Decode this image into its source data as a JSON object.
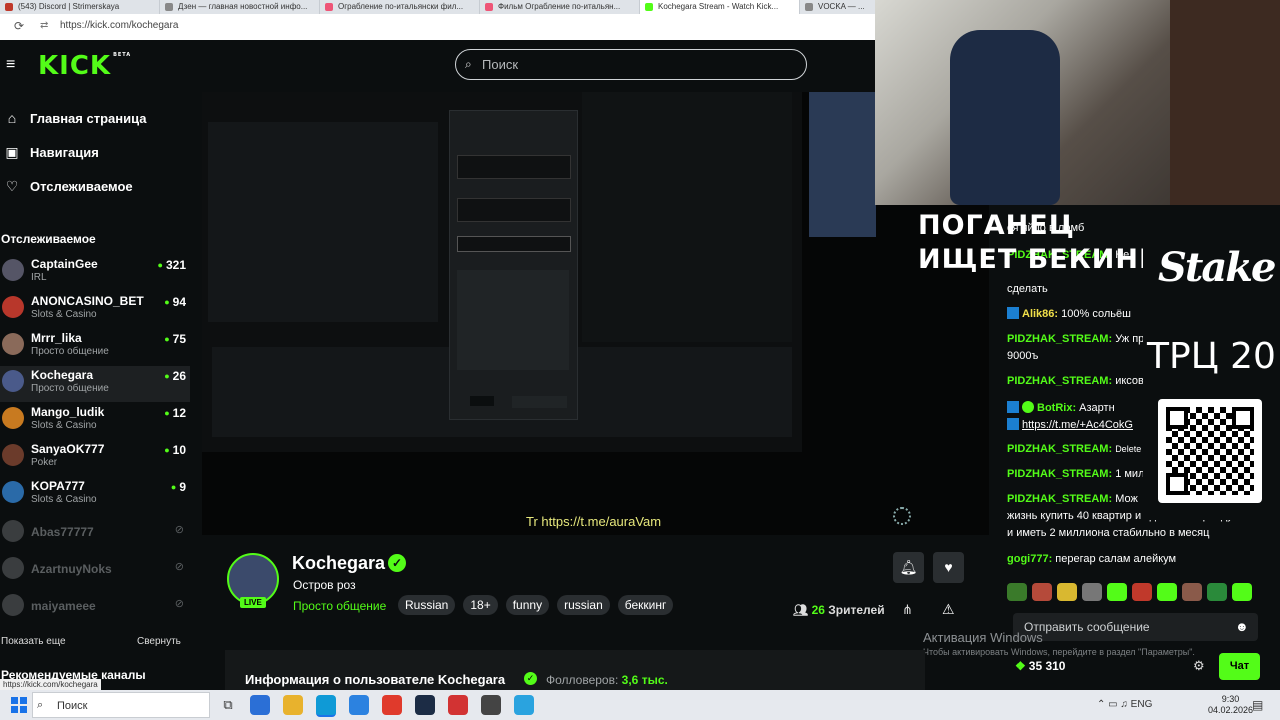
{
  "browser": {
    "tabs": [
      "(543) Discord | Strimerskaya",
      "Дзен — главная новостной инфо...",
      "Ограбление по-итальянски фил...",
      "Фильм Ограбление по-итальян...",
      "Kochegara Stream - Watch Kick...",
      "VOCKA — ..."
    ],
    "url": "https://kick.com/kochegara"
  },
  "header": {
    "logo": "KICK",
    "logo_beta": "BETA",
    "search_placeholder": "Поиск"
  },
  "sidebar": {
    "nav": [
      {
        "label": "Главная страница",
        "icon": "home-icon"
      },
      {
        "label": "Навигация",
        "icon": "browse-icon"
      },
      {
        "label": "Отслеживаемое",
        "icon": "heart-icon"
      }
    ],
    "section_title": "Отслеживаемое",
    "channels": [
      {
        "name": "CaptainGee",
        "category": "IRL",
        "viewers": "321"
      },
      {
        "name": "ANONCASINO_BET",
        "category": "Slots & Casino",
        "viewers": "94"
      },
      {
        "name": "Mrrr_lika",
        "category": "Просто общение",
        "viewers": "75"
      },
      {
        "name": "Kochegara",
        "category": "Просто общение",
        "viewers": "26"
      },
      {
        "name": "Mango_ludik",
        "category": "Slots & Casino",
        "viewers": "12"
      },
      {
        "name": "SanyaOK777",
        "category": "Poker",
        "viewers": "10"
      },
      {
        "name": "KOPA777",
        "category": "Slots & Casino",
        "viewers": "9"
      }
    ],
    "offline_channels": [
      "Abas77777",
      "AzartnuyNoks",
      "maiyameee"
    ],
    "show_more": "Показать еще",
    "collapse": "Свернуть",
    "recommended": "Рекомендуемые каналы",
    "status_url": "https://kick.com/kochegara"
  },
  "player": {
    "promo_text": "Tr https://t.me/auraVam"
  },
  "overlay": {
    "line1": "ПОГАНЕЦ",
    "line2": "ИЩЕТ БЕКИНГ",
    "stake": "Stake",
    "trc": "ТРЦ 20"
  },
  "chat": {
    "messages": [
      {
        "user": "",
        "text": "ся яйцо в ломб"
      },
      {
        "user": "PIDZHAK_STREAM:",
        "text": "Не"
      },
      {
        "user": "",
        "text": "сделать"
      },
      {
        "user": "Alik86:",
        "text": "100% сольёш"
      },
      {
        "user": "PIDZHAK_STREAM:",
        "text": "Уж пр"
      },
      {
        "user": "",
        "text": "9000ъ"
      },
      {
        "user": "PIDZHAK_STREAM:",
        "text": "иксов"
      },
      {
        "user": "BotRix:",
        "text": "Азартн"
      },
      {
        "user": "",
        "text": "https://t.me/+Ac4CokG"
      },
      {
        "user": "PIDZHAK_STREAM:",
        "text": "Delete"
      },
      {
        "user": "PIDZHAK_STREAM:",
        "text": "1 мил"
      },
      {
        "user": "PIDZHAK_STREAM:",
        "text": "Мож"
      },
      {
        "user": "",
        "text": "жизнь купить 40 квартир и сдавать в аренду"
      },
      {
        "user": "",
        "text": "и иметь 2 миллиона стабильно в месяц"
      },
      {
        "user": "gogi777:",
        "text": "перегар салам алейкум"
      }
    ],
    "input_placeholder": "Отправить сообщение",
    "points": "35 310",
    "chat_button": "Чат"
  },
  "windows_activation": {
    "line1": "Активация Windows",
    "line2": "Чтобы активировать Windows, перейдите в раздел \"Параметры\"."
  },
  "channel": {
    "name": "Kochegara",
    "live_label": "LIVE",
    "stream_title": "Остров роз",
    "category": "Просто общение",
    "tags": [
      "Russian",
      "18+",
      "funny",
      "russian",
      "беккинг"
    ],
    "viewers": "26",
    "viewers_label": "Зрителей",
    "info_title": "Информация о пользователе Kochegara",
    "followers_label": "Фолловеров:",
    "followers": "3,6 тыс."
  },
  "taskbar": {
    "search_label": "Поиск",
    "time": "9:30",
    "date": "04.02.2026",
    "tray_lang": "ENG"
  },
  "colors": {
    "accent": "#53fc18",
    "background": "#0b0e0f"
  }
}
